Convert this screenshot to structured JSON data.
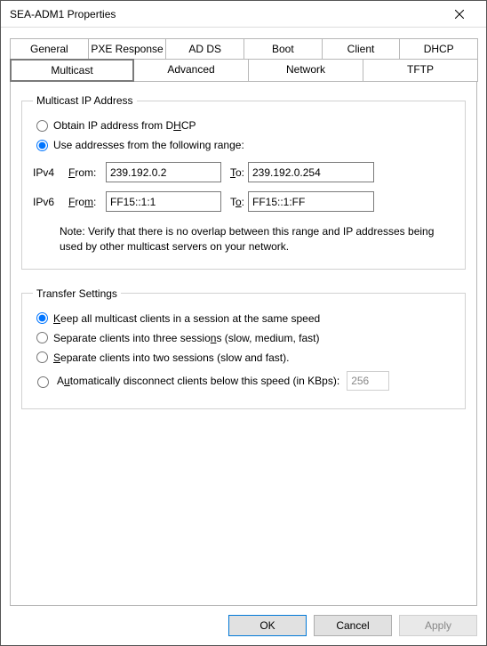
{
  "window_title": "SEA-ADM1 Properties",
  "tabs_row1": [
    "General",
    "PXE Response",
    "AD DS",
    "Boot",
    "Client",
    "DHCP"
  ],
  "tabs_row2": [
    "Multicast",
    "Advanced",
    "Network",
    "TFTP"
  ],
  "active_tab": "Multicast",
  "multicast_group": {
    "legend": "Multicast IP Address",
    "opt_dhcp": "Obtain IP address from DHCP",
    "opt_range": "Use addresses from the following range:",
    "ipv4_label": "IPv4",
    "ipv6_label": "IPv6",
    "from_prefix": "F",
    "from_rest": "rom:",
    "to_prefix": "T",
    "to_rest": "o:",
    "ipv4_from": "239.192.0.2",
    "ipv4_to": "239.192.0.254",
    "ipv6_from": "FF15::1:1",
    "ipv6_to": "FF15::1:FF",
    "note": "Note: Verify that there is no overlap between this range and IP addresses being used by other multicast servers on your network."
  },
  "transfer_group": {
    "legend": "Transfer Settings",
    "opt_keep": {
      "u": "K",
      "rest": "eep all multicast clients in a session at the same speed"
    },
    "opt_three": {
      "pre": "Separate clients into three sessio",
      "u": "n",
      "rest": "s (slow, medium, fast)"
    },
    "opt_two": {
      "u": "S",
      "rest": "eparate clients into two sessions (slow and fast)."
    },
    "opt_auto": {
      "pre": "A",
      "u": "u",
      "rest": "tomatically disconnect clients below this speed (in KBps):"
    },
    "kbps_value": "256"
  },
  "buttons": {
    "ok": "OK",
    "cancel": "Cancel",
    "apply": "Apply"
  }
}
